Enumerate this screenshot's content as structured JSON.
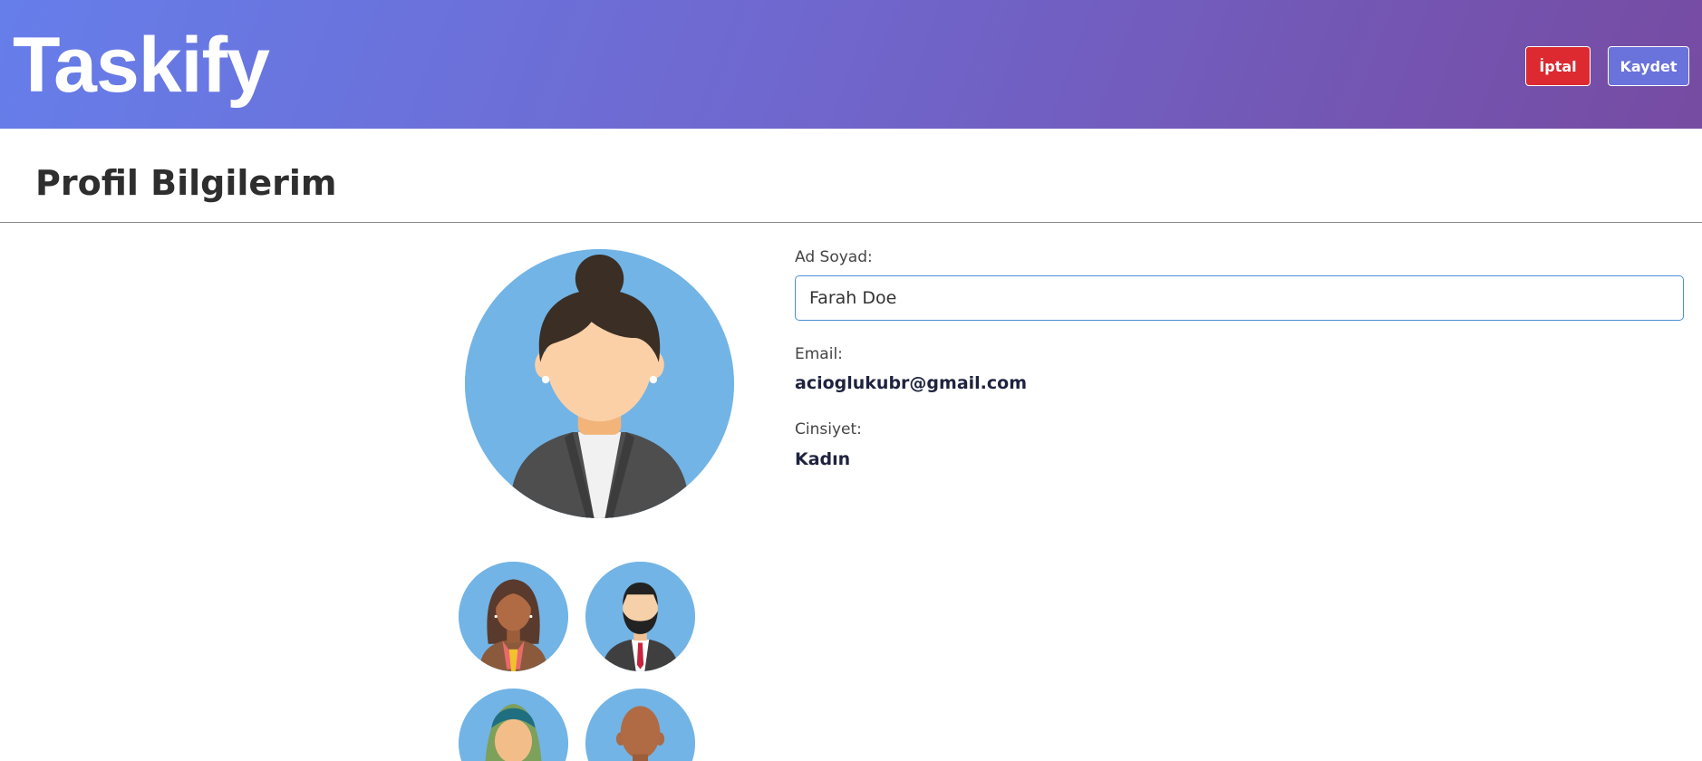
{
  "app": {
    "title": "Taskify"
  },
  "header": {
    "cancel_label": "İptal",
    "save_label": "Kaydet",
    "gradient_start": "#667eea",
    "gradient_end": "#764ba2",
    "cancel_color": "#dc2a30"
  },
  "page": {
    "title": "Profil Bilgilerim"
  },
  "profile": {
    "name_label": "Ad Soyad:",
    "name_value": "Farah Doe",
    "email_label": "Email:",
    "email_value": "acioglukubr@gmail.com",
    "gender_label": "Cinsiyet:",
    "gender_value": "Kadın"
  },
  "avatars": {
    "selected": "woman-bun-avatar",
    "options": [
      "woman-long-hair-avatar",
      "man-beard-avatar",
      "woman-hijab-avatar",
      "man-bald-avatar"
    ],
    "background_color": "#72b4e6"
  }
}
